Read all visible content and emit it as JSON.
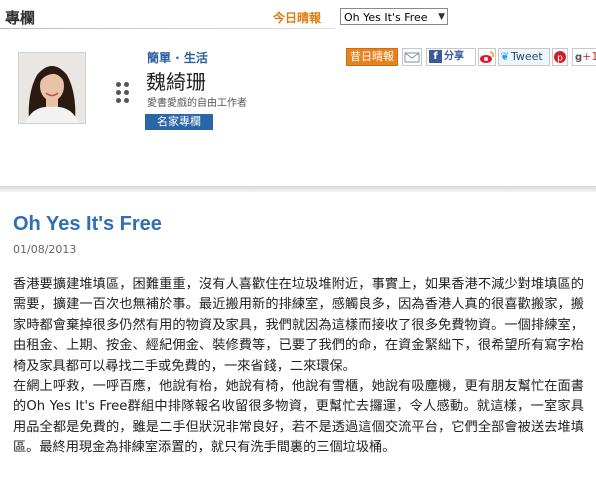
{
  "header": {
    "section_title": "專欄",
    "today_label": "今日晴報",
    "article_select": "Oh Yes It's Free"
  },
  "author": {
    "category": "簡單 · 生活",
    "name": "魏綺珊",
    "description": "愛書愛戲的自由工作者",
    "badge": "名家專欄"
  },
  "toolbar": {
    "today_button": "昔日晴報",
    "facebook": "分享",
    "tweet": "Tweet",
    "gplus": "+1"
  },
  "article": {
    "title": "Oh Yes It's Free",
    "date": "01/08/2013",
    "paragraphs": [
      "香港要擴建堆填區，困難重重，沒有人喜歡住在垃圾堆附近，事實上，如果香港不減少對堆填區的需要，擴建一百次也無補於事。最近搬用新的排練室，感觸良多，因為香港人真的很喜歡搬家，搬家時都會棄掉很多仍然有用的物資及家具，我們就因為這樣而接收了很多免費物資。一個排練室，由租金、上期、按金、經紀佣金、裝修費等，已要了我們的命，在資金緊絀下，很希望所有寫字枱椅及家具都可以尋找二手或免費的，一來省錢，二來環保。",
      "在網上呼救，一呼百應，他說有枱，她說有椅，他說有雪櫃，她說有吸塵機，更有朋友幫忙在面書的Oh Yes It's Free群組中排隊報名收留很多物資，更幫忙去攞運，令人感動。就這樣，一室家具用品全都是免費的，雖是二手但狀況非常良好，若不是透過這個交流平台，它們全部會被送去堆填區。最終用現金為排練室添置的，就只有洗手間裏的三個垃圾桶。"
    ]
  },
  "colors": {
    "accent_orange": "#e07a10",
    "title_blue": "#2f6fb2",
    "badge_blue": "#2a66a8"
  }
}
